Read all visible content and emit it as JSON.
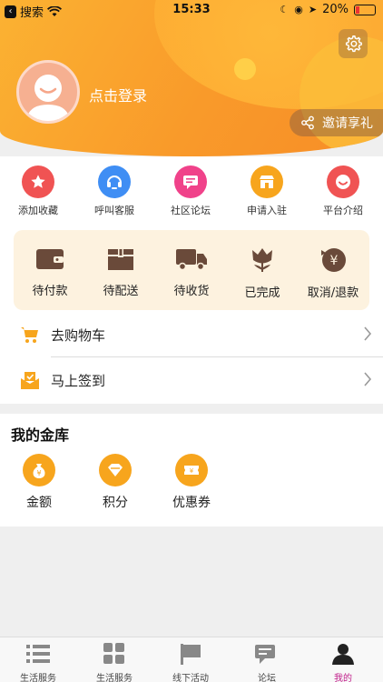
{
  "status": {
    "left_label": "搜索",
    "time": "15:33",
    "battery": "20%"
  },
  "header": {
    "login_text": "点击登录",
    "invite_label": "邀请享礼"
  },
  "quick_actions": [
    {
      "label": "添加收藏",
      "icon": "star-icon",
      "color": "#f05353"
    },
    {
      "label": "呼叫客服",
      "icon": "headset-icon",
      "color": "#3f8ef4"
    },
    {
      "label": "社区论坛",
      "icon": "chat-icon",
      "color": "#f0428a"
    },
    {
      "label": "申请入驻",
      "icon": "store-icon",
      "color": "#f7a51d"
    },
    {
      "label": "平台介绍",
      "icon": "smile-icon",
      "color": "#f05353"
    }
  ],
  "orders": [
    {
      "label": "待付款",
      "icon": "wallet-icon"
    },
    {
      "label": "待配送",
      "icon": "box-icon"
    },
    {
      "label": "待收货",
      "icon": "truck-icon"
    },
    {
      "label": "已完成",
      "icon": "flower-icon"
    },
    {
      "label": "取消/退款",
      "icon": "refund-icon"
    }
  ],
  "rows": [
    {
      "label": "去购物车",
      "icon": "cart-icon"
    },
    {
      "label": "马上签到",
      "icon": "checkin-icon"
    }
  ],
  "vault": {
    "title": "我的金库",
    "items": [
      {
        "label": "金额",
        "icon": "money-bag-icon"
      },
      {
        "label": "积分",
        "icon": "diamond-icon"
      },
      {
        "label": "优惠券",
        "icon": "coupon-icon"
      }
    ]
  },
  "tabs": [
    {
      "label": "生活服务",
      "icon": "list-icon"
    },
    {
      "label": "生活服务",
      "icon": "grid-icon"
    },
    {
      "label": "线下活动",
      "icon": "flag-icon"
    },
    {
      "label": "论坛",
      "icon": "forum-icon"
    },
    {
      "label": "我的",
      "icon": "user-icon",
      "active": true
    }
  ],
  "colors": {
    "accent_orange": "#f99a2a",
    "active_tab": "#c01f8a",
    "order_bg": "#fdf2df",
    "order_icon": "#6a4a3a"
  }
}
